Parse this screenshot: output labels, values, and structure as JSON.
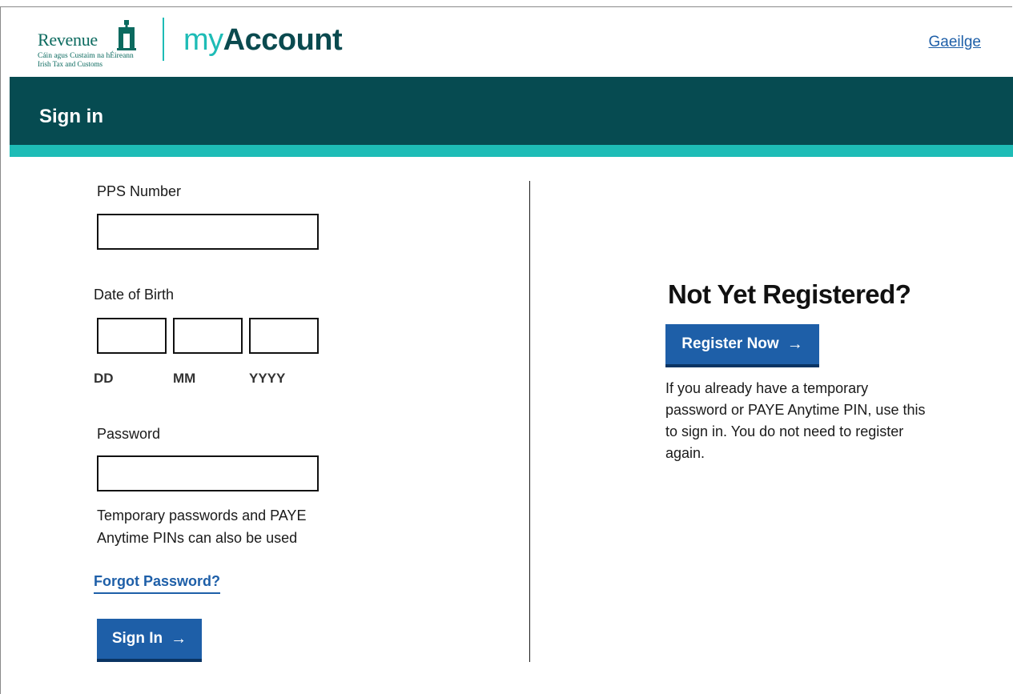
{
  "header": {
    "logo": {
      "word": "Revenue",
      "sub_irish": "Cáin agus Custaim na hÉireann",
      "sub_english": "Irish Tax and Customs"
    },
    "app_name_prefix": "my",
    "app_name_suffix": "Account",
    "language_link": "Gaeilge"
  },
  "banner": {
    "title": "Sign in"
  },
  "form": {
    "pps_label": "PPS Number",
    "pps_value": "",
    "dob_label": "Date of Birth",
    "dob_day_label": "DD",
    "dob_month_label": "MM",
    "dob_year_label": "YYYY",
    "password_label": "Password",
    "password_hint": "Temporary passwords and PAYE Anytime PINs can also be used",
    "forgot_password": "Forgot Password?",
    "sign_in_button": "Sign In"
  },
  "register": {
    "title": "Not Yet Registered?",
    "button": "Register Now",
    "info": "If you already have a temporary password or PAYE Anytime PIN, use this to sign in. You do not need to register again."
  },
  "colors": {
    "brand_dark": "#064b51",
    "brand_accent": "#1ebcb6",
    "button": "#1e5fa8"
  },
  "icons": {
    "button_arrow": "arrow-right-icon",
    "crest": "revenue-crest-icon"
  }
}
